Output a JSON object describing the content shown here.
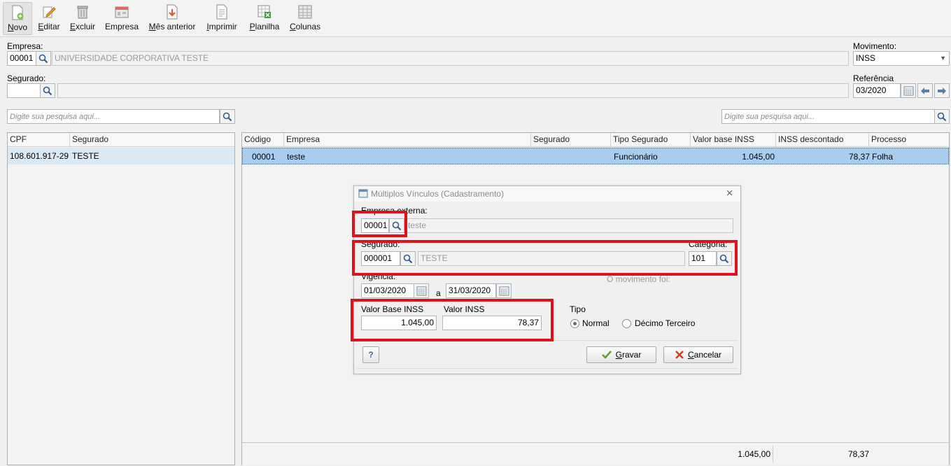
{
  "toolbar": {
    "items": [
      {
        "label": "Novo",
        "icon": "new-document-icon"
      },
      {
        "label": "Editar",
        "icon": "edit-icon"
      },
      {
        "label": "Excluir",
        "icon": "trash-icon"
      },
      {
        "label": "Empresa",
        "icon": "company-icon"
      },
      {
        "label": "Mês anterior",
        "icon": "previous-month-icon"
      },
      {
        "label": "Imprimir",
        "icon": "print-icon"
      },
      {
        "label": "Planilha",
        "icon": "spreadsheet-icon"
      },
      {
        "label": "Colunas",
        "icon": "columns-icon"
      }
    ]
  },
  "form": {
    "empresa_label": "Empresa:",
    "empresa_code": "00001",
    "empresa_name": "UNIVERSIDADE CORPORATIVA TESTE",
    "segurado_label": "Segurado:",
    "segurado_code": "",
    "segurado_name": "",
    "movimento_label": "Movimento:",
    "movimento_value": "INSS",
    "referencia_label": "Referência",
    "referencia_value": "03/2020"
  },
  "left_search": {
    "placeholder": "Digite sua pesquisa aqui..."
  },
  "right_search": {
    "placeholder": "Digite sua pesquisa aqui..."
  },
  "left_grid": {
    "columns": [
      "CPF",
      "Segurado"
    ],
    "rows": [
      [
        "108.601.917-29",
        "TESTE"
      ]
    ]
  },
  "right_grid": {
    "columns": [
      "Código",
      "Empresa",
      "Segurado",
      "Tipo Segurado",
      "Valor base INSS",
      "INSS descontado",
      "Processo"
    ],
    "rows": [
      [
        "00001",
        "teste",
        "",
        "Funcionário",
        "1.045,00",
        "78,37",
        "Folha"
      ]
    ],
    "totals": {
      "base": "1.045,00",
      "descontado": "78,37"
    }
  },
  "dialog": {
    "title": "Múltiplos Vínculos (Cadastramento)",
    "empresa_externa_label": "Empresa externa:",
    "empresa_externa_code": "00001",
    "empresa_externa_name": "teste",
    "segurado_label": "Segurado:",
    "segurado_code": "000001",
    "segurado_name": "TESTE",
    "categoria_label": "Categoria:",
    "categoria_value": "101",
    "vigencia_label": "Vigência:",
    "vigencia_from": "01/03/2020",
    "vigencia_sep": "a",
    "vigencia_to": "31/03/2020",
    "movimento_info": "O movimento foi:",
    "valor_base_label": "Valor Base INSS",
    "valor_base_value": "1.045,00",
    "valor_inss_label": "Valor INSS",
    "valor_inss_value": "78,37",
    "tipo_label": "Tipo",
    "tipo_options": [
      "Normal",
      "Décimo Terceiro"
    ],
    "tipo_selected": "Normal",
    "help_label": "?",
    "gravar_label": "Gravar",
    "cancelar_label": "Cancelar"
  },
  "colors": {
    "accent": "#e0111b",
    "selection": "#cfe6f8"
  }
}
